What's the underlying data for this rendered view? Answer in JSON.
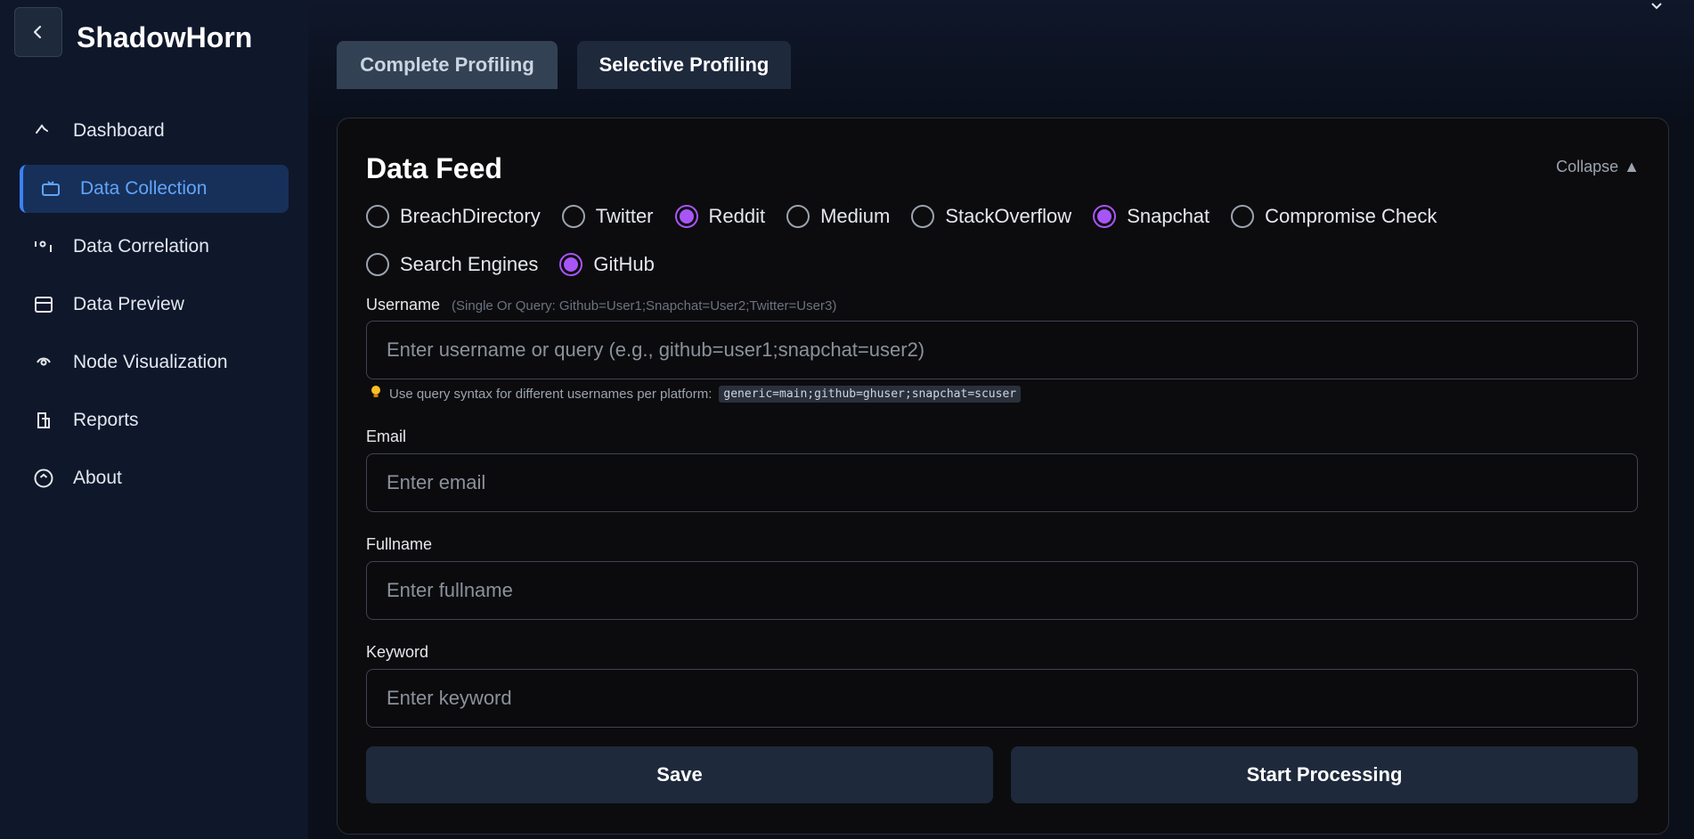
{
  "app": {
    "name": "ShadowHorn"
  },
  "sidebar": {
    "items": [
      {
        "label": "Dashboard",
        "icon": "dashboard-icon",
        "active": false
      },
      {
        "label": "Data Collection",
        "icon": "tv-icon",
        "active": true
      },
      {
        "label": "Data Correlation",
        "icon": "correlation-icon",
        "active": false
      },
      {
        "label": "Data Preview",
        "icon": "layout-icon",
        "active": false
      },
      {
        "label": "Node Visualization",
        "icon": "eye-icon",
        "active": false
      },
      {
        "label": "Reports",
        "icon": "report-icon",
        "active": false
      },
      {
        "label": "About",
        "icon": "info-circle-icon",
        "active": false
      }
    ]
  },
  "tabs": [
    {
      "label": "Complete Profiling"
    },
    {
      "label": "Selective Profiling"
    }
  ],
  "panel": {
    "title": "Data Feed",
    "collapse_label": "Collapse",
    "collapse_arrow": "▲"
  },
  "platforms": [
    {
      "label": "BreachDirectory",
      "checked": false
    },
    {
      "label": "Twitter",
      "checked": false
    },
    {
      "label": "Reddit",
      "checked": true
    },
    {
      "label": "Medium",
      "checked": false
    },
    {
      "label": "StackOverflow",
      "checked": false
    },
    {
      "label": "Snapchat",
      "checked": true
    },
    {
      "label": "Compromise Check",
      "checked": false
    },
    {
      "label": "Search Engines",
      "checked": false
    },
    {
      "label": "GitHub",
      "checked": true
    }
  ],
  "fields": {
    "username": {
      "label": "Username",
      "hint": "(Single Or Query: Github=User1;Snapchat=User2;Twitter=User3)",
      "placeholder": "Enter username or query (e.g., github=user1;snapchat=user2)",
      "value": ""
    },
    "tip": {
      "text": "Use query syntax for different usernames per platform:",
      "code": "generic=main;github=ghuser;snapchat=scuser"
    },
    "email": {
      "label": "Email",
      "placeholder": "Enter email",
      "value": ""
    },
    "fullname": {
      "label": "Fullname",
      "placeholder": "Enter fullname",
      "value": ""
    },
    "keyword": {
      "label": "Keyword",
      "placeholder": "Enter keyword",
      "value": ""
    }
  },
  "actions": {
    "save_label": "Save",
    "start_label": "Start Processing"
  },
  "colors": {
    "accent": "#a855f7",
    "active_nav": "#60a5fa",
    "sidebar_bg": "#0f172a",
    "button_bg": "#1e293b"
  }
}
